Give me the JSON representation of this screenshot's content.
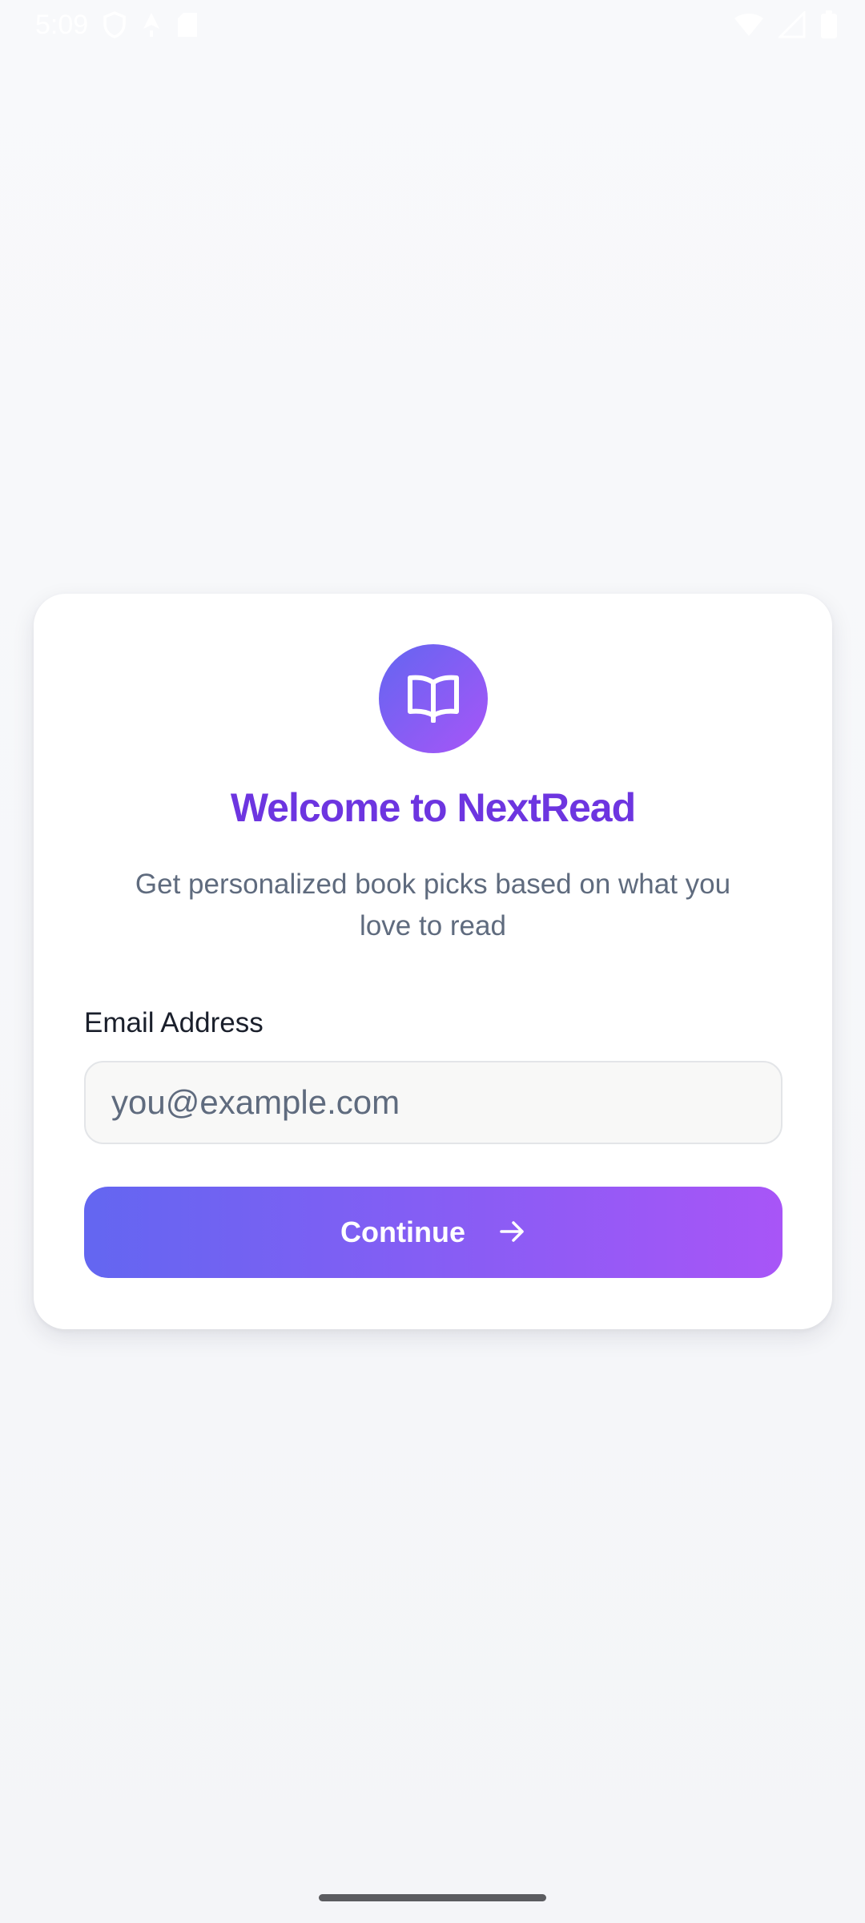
{
  "status_bar": {
    "time": "5:09",
    "left_icons": [
      "shield-icon",
      "nav-icon",
      "sd-card-icon"
    ],
    "right_icons": [
      "wifi-icon",
      "signal-icon",
      "battery-icon"
    ]
  },
  "login": {
    "logo_icon": "open-book-icon",
    "title": "Welcome to NextRead",
    "subtitle": "Get personalized book picks based on what you love to read",
    "email_label": "Email Address",
    "email_placeholder": "you@example.com",
    "email_value": "",
    "continue_label": "Continue",
    "continue_icon": "arrow-right-icon"
  },
  "colors": {
    "accent_start": "#6366f1",
    "accent_end": "#a855f7",
    "title": "#6d35e0",
    "subtitle": "#5f6b7e"
  }
}
